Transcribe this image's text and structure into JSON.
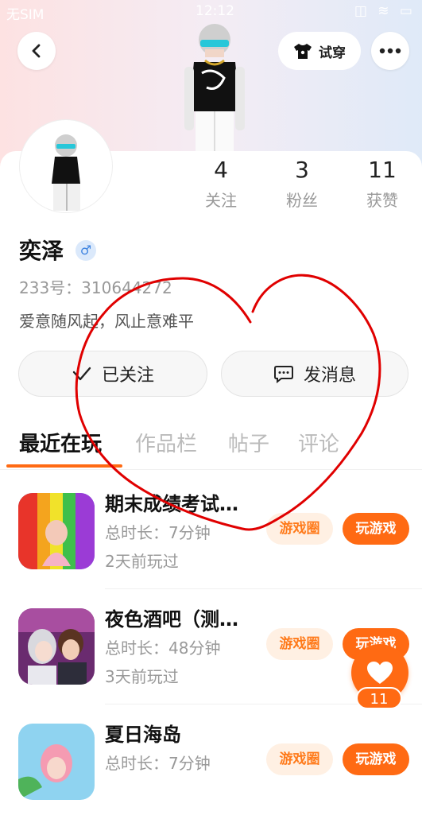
{
  "status_bar": {
    "left": "无SIM",
    "time": "12:12",
    "right": "◫ ≋ ▭"
  },
  "header": {
    "try_on_label": "试穿"
  },
  "stats": [
    {
      "count": "4",
      "label": "关注"
    },
    {
      "count": "3",
      "label": "粉丝"
    },
    {
      "count": "11",
      "label": "获赞"
    }
  ],
  "profile": {
    "name": "奕泽",
    "gender_symbol": "♂",
    "uid": "233号：310644272",
    "bio": "爱意随风起，风止意难平"
  },
  "actions": {
    "followed_label": "已关注",
    "message_label": "发消息"
  },
  "tabs": [
    "最近在玩",
    "作品栏",
    "帖子",
    "评论"
  ],
  "games": [
    {
      "title": "期末成绩考试…",
      "duration": "总时长：7分钟",
      "last_played": "2天前玩过",
      "circle_label": "游戏圈",
      "play_label": "玩游戏"
    },
    {
      "title": "夜色酒吧（测…",
      "duration": "总时长：48分钟",
      "last_played": "3天前玩过",
      "circle_label": "游戏圈",
      "play_label": "玩游戏"
    },
    {
      "title": "夏日海岛",
      "duration": "总时长：7分钟",
      "last_played": "",
      "circle_label": "游戏圈",
      "play_label": "玩游戏"
    }
  ],
  "fab": {
    "like_count": "11"
  },
  "colors": {
    "accent": "#ff6a13",
    "doodle": "#e00000"
  },
  "icons": [
    "back-icon",
    "shirt-icon",
    "more-icon",
    "check-icon",
    "message-icon",
    "heart-icon",
    "male-icon"
  ]
}
